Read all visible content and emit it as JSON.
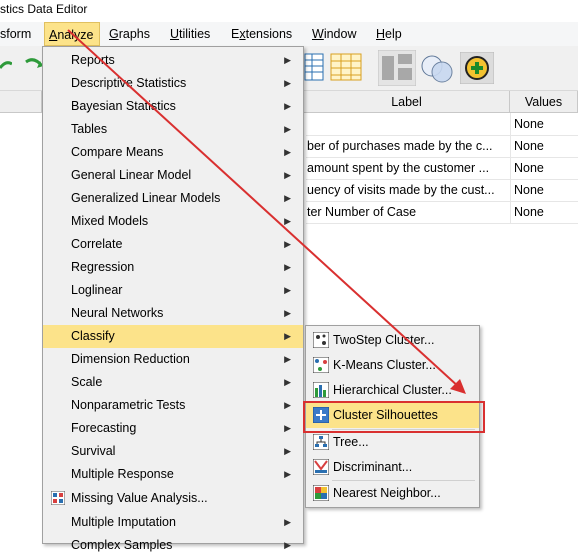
{
  "window": {
    "title": "stics Data Editor"
  },
  "menubar": {
    "items": [
      {
        "label": "sform",
        "ul": ""
      },
      {
        "label": "Analyze",
        "ul": "A",
        "rest": "nalyze"
      },
      {
        "label": "Graphs",
        "ul": "G",
        "rest": "raphs"
      },
      {
        "label": "Utilities",
        "ul": "U",
        "rest": "tilities"
      },
      {
        "label": "Extensions",
        "ul": "x",
        "pre": "E",
        "rest": "tensions"
      },
      {
        "label": "Window",
        "ul": "W",
        "rest": "indow"
      },
      {
        "label": "Help",
        "ul": "H",
        "rest": "elp"
      }
    ]
  },
  "grid": {
    "headers": {
      "label": "Label",
      "values": "Values"
    },
    "rows": [
      {
        "label": "",
        "values": "None"
      },
      {
        "label": "ber of purchases made by the c...",
        "values": "None"
      },
      {
        "label": " amount spent by the customer ...",
        "values": "None"
      },
      {
        "label": "uency of visits made by the cust...",
        "values": "None"
      },
      {
        "label": "ter Number of Case",
        "values": "None"
      }
    ]
  },
  "analyze_menu": {
    "items": [
      {
        "label": "Reports",
        "has_submenu": true
      },
      {
        "label": "Descriptive Statistics",
        "has_submenu": true
      },
      {
        "label": "Bayesian Statistics",
        "has_submenu": true
      },
      {
        "label": "Tables",
        "has_submenu": true
      },
      {
        "label": "Compare Means",
        "has_submenu": true
      },
      {
        "label": "General Linear Model",
        "has_submenu": true
      },
      {
        "label": "Generalized Linear Models",
        "has_submenu": true
      },
      {
        "label": "Mixed Models",
        "has_submenu": true
      },
      {
        "label": "Correlate",
        "has_submenu": true
      },
      {
        "label": "Regression",
        "has_submenu": true
      },
      {
        "label": "Loglinear",
        "has_submenu": true
      },
      {
        "label": "Neural Networks",
        "has_submenu": true
      },
      {
        "label": "Classify",
        "has_submenu": true,
        "highlighted": true
      },
      {
        "label": "Dimension Reduction",
        "has_submenu": true
      },
      {
        "label": "Scale",
        "has_submenu": true
      },
      {
        "label": "Nonparametric Tests",
        "has_submenu": true
      },
      {
        "label": "Forecasting",
        "has_submenu": true
      },
      {
        "label": "Survival",
        "has_submenu": true
      },
      {
        "label": "Multiple Response",
        "has_submenu": true
      },
      {
        "label": "Missing Value Analysis...",
        "has_submenu": false,
        "icon": "missing-value-icon"
      },
      {
        "label": "Multiple Imputation",
        "has_submenu": true
      },
      {
        "label": "Complex Samples",
        "has_submenu": true
      }
    ]
  },
  "classify_menu": {
    "items": [
      {
        "label": "TwoStep Cluster...",
        "icon": "twostep-cluster-icon"
      },
      {
        "label": "K-Means Cluster...",
        "icon": "kmeans-cluster-icon"
      },
      {
        "label": "Hierarchical Cluster...",
        "icon": "hierarchical-cluster-icon"
      },
      {
        "label": "Cluster Silhouettes",
        "icon": "cluster-silhouettes-icon",
        "highlighted": true
      },
      {
        "label": "Tree...",
        "icon": "tree-icon"
      },
      {
        "label": "Discriminant...",
        "icon": "discriminant-icon"
      },
      {
        "label": "Nearest Neighbor...",
        "icon": "nearest-neighbor-icon"
      }
    ]
  },
  "colors": {
    "highlight": "#fce38a",
    "annotation_red": "#d93030"
  }
}
